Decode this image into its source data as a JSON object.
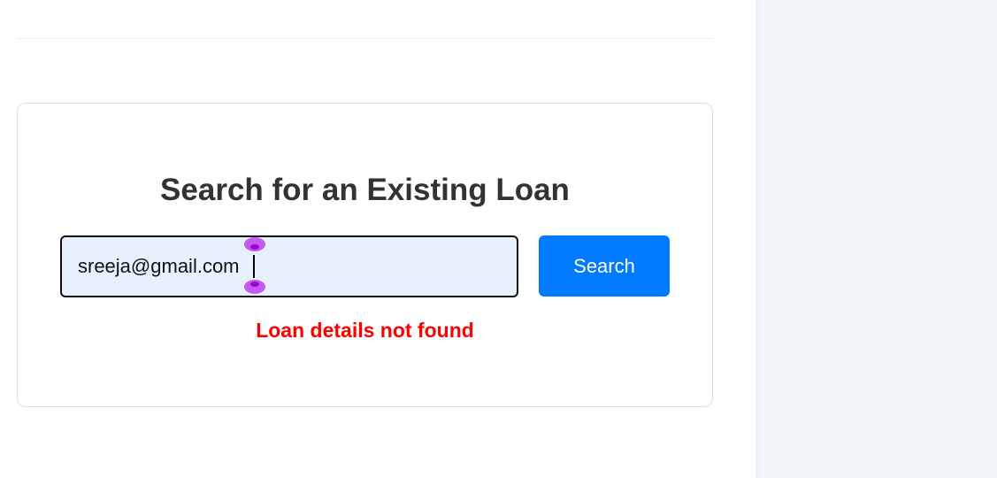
{
  "search_card": {
    "title": "Search for an Existing Loan",
    "input_value": "sreeja@gmail.com",
    "button_label": "Search",
    "error_message": "Loan details not found"
  },
  "colors": {
    "button_background": "#007bff",
    "error_text": "#ff0000",
    "input_background": "#e8f0fe",
    "sidebar_background": "#f3f6f9",
    "selection_handle": "#c05cf0"
  }
}
